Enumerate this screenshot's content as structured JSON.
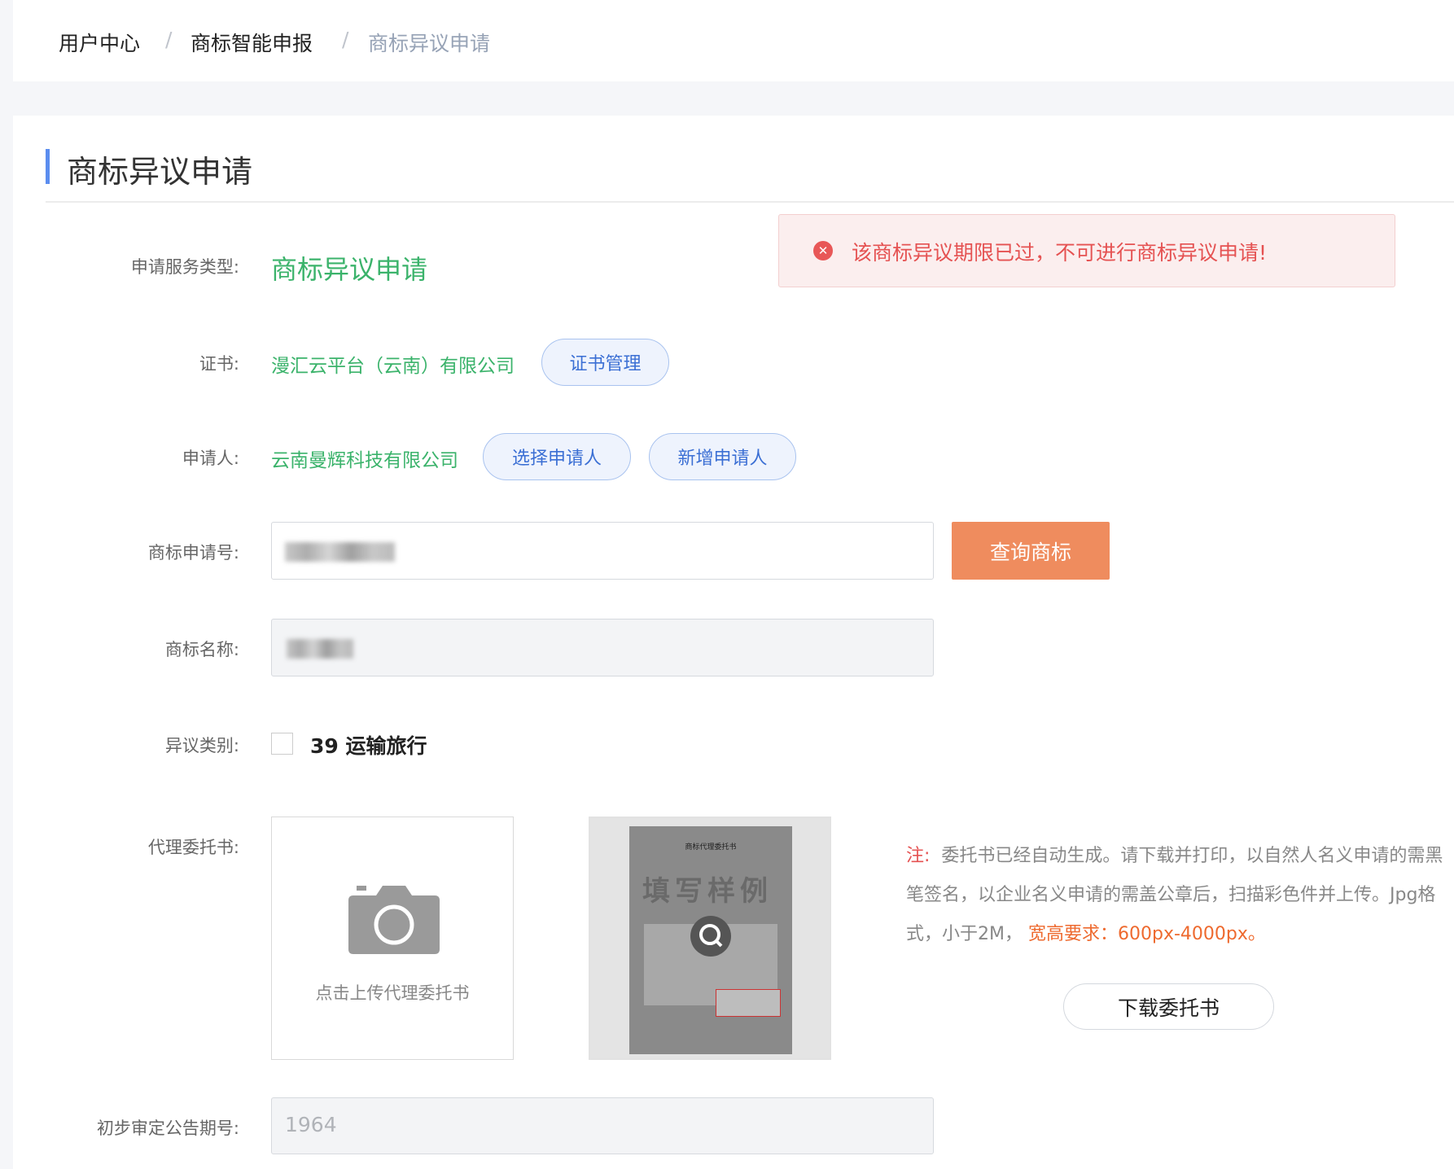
{
  "breadcrumb": {
    "items": [
      "用户中心",
      "商标智能申报",
      "商标异议申请"
    ],
    "separator": "/"
  },
  "page_title": "商标异议申请",
  "alert": {
    "icon": "error-circle-icon",
    "text": "该商标异议期限已过，不可进行商标异议申请!"
  },
  "form": {
    "service_type": {
      "label": "申请服务类型:",
      "value": "商标异议申请"
    },
    "certificate": {
      "label": "证书:",
      "value": "漫汇云平台（云南）有限公司",
      "button": "证书管理"
    },
    "applicant": {
      "label": "申请人:",
      "value": "云南曼辉科技有限公司",
      "select_button": "选择申请人",
      "add_button": "新增申请人"
    },
    "app_number": {
      "label": "商标申请号:",
      "query_button": "查询商标"
    },
    "name": {
      "label": "商标名称:"
    },
    "category": {
      "label": "异议类别:",
      "option": "39 运输旅行",
      "checked": false
    },
    "power_of_attorney": {
      "label": "代理委托书:",
      "upload_text": "点击上传代理委托书",
      "sample_title": "商标代理委托书",
      "sample_watermark": "填写样例"
    },
    "note": {
      "prefix": "注:",
      "text": "委托书已经自动生成。请下载并打印，以自然人名义申请的需黑笔签名，以企业名义申请的需盖公章后，扫描彩色件并上传。Jpg格式，小于2M，",
      "highlight": "宽高要求：600px-4000px。"
    },
    "download_button": "下载委托书",
    "announcement": {
      "label": "初步审定公告期号:",
      "value": "1964"
    }
  }
}
